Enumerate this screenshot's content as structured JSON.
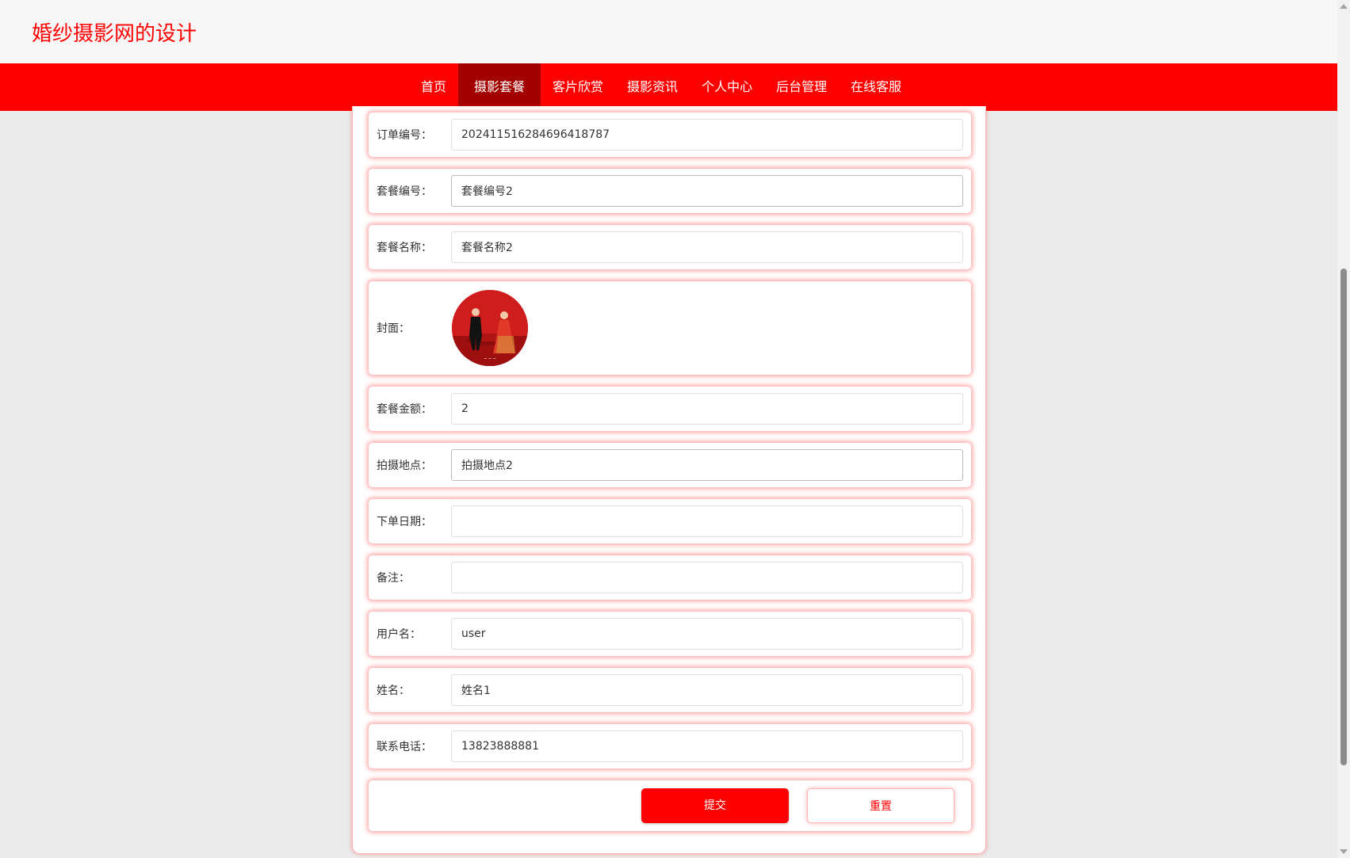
{
  "site": {
    "title": "婚纱摄影网的设计"
  },
  "nav": {
    "items": [
      {
        "label": "首页",
        "active": false
      },
      {
        "label": "摄影套餐",
        "active": true
      },
      {
        "label": "客片欣赏",
        "active": false
      },
      {
        "label": "摄影资讯",
        "active": false
      },
      {
        "label": "个人中心",
        "active": false
      },
      {
        "label": "后台管理",
        "active": false
      },
      {
        "label": "在线客服",
        "active": false
      }
    ]
  },
  "form": {
    "fields": [
      {
        "label": "订单编号：",
        "value": "202411516284696418787",
        "placeholder": ""
      },
      {
        "label": "套餐编号：",
        "value": "套餐编号2",
        "placeholder": ""
      },
      {
        "label": "套餐名称：",
        "value": "套餐名称2",
        "placeholder": ""
      },
      {
        "label": "封面：",
        "image": "wedding-couple-cover"
      },
      {
        "label": "套餐金额：",
        "value": "2",
        "placeholder": ""
      },
      {
        "label": "拍摄地点：",
        "value": "拍摄地点2",
        "placeholder": ""
      },
      {
        "label": "下单日期：",
        "value": "",
        "placeholder": ""
      },
      {
        "label": "备注：",
        "value": "",
        "placeholder": ""
      },
      {
        "label": "用户名：",
        "value": "user",
        "placeholder": ""
      },
      {
        "label": "姓名：",
        "value": "姓名1",
        "placeholder": ""
      },
      {
        "label": "联系电话：",
        "value": "13823888881",
        "placeholder": ""
      }
    ],
    "submit_label": "提交",
    "reset_label": "重置"
  },
  "colors": {
    "brand": "#ff0000",
    "nav_active": "#a30000",
    "page_bg": "#ebebeb"
  }
}
